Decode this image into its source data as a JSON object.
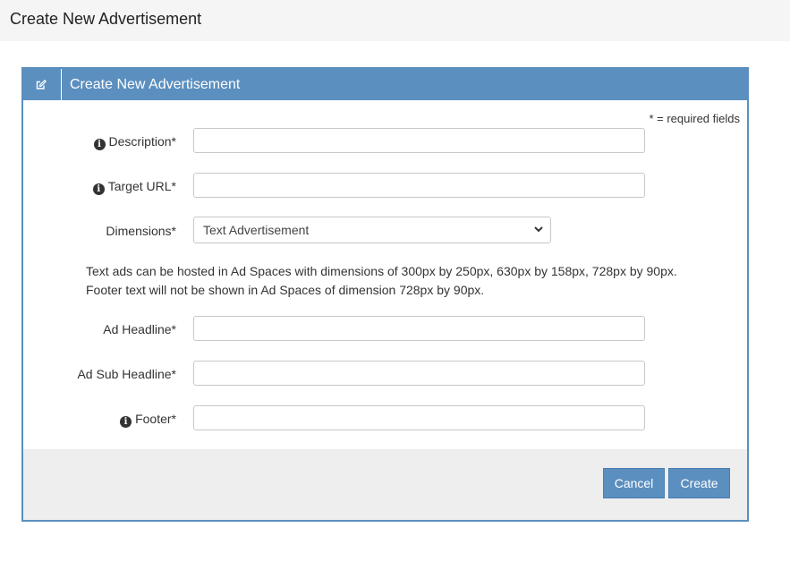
{
  "page": {
    "title": "Create New Advertisement"
  },
  "panel": {
    "title": "Create New Advertisement",
    "header_icon": "edit-icon",
    "required_note": "* = required fields"
  },
  "form": {
    "description": {
      "label": "Description*",
      "value": "",
      "has_info": true
    },
    "target_url": {
      "label": "Target URL*",
      "value": "",
      "has_info": true
    },
    "dimensions": {
      "label": "Dimensions*",
      "selected": "Text Advertisement"
    },
    "help_line_1": "Text ads can be hosted in Ad Spaces with dimensions of 300px by 250px, 630px by 158px, 728px by 90px.",
    "help_line_2": "Footer text will not be shown in Ad Spaces of dimension 728px by 90px.",
    "ad_headline": {
      "label": "Ad Headline*",
      "value": ""
    },
    "ad_sub_headline": {
      "label": "Ad Sub Headline*",
      "value": ""
    },
    "footer": {
      "label": "Footer*",
      "value": "",
      "has_info": true
    }
  },
  "actions": {
    "cancel_label": "Cancel",
    "create_label": "Create"
  },
  "colors": {
    "accent": "#5b8fbf",
    "header_bg": "#f5f5f5",
    "footer_bg": "#eeeeee"
  }
}
